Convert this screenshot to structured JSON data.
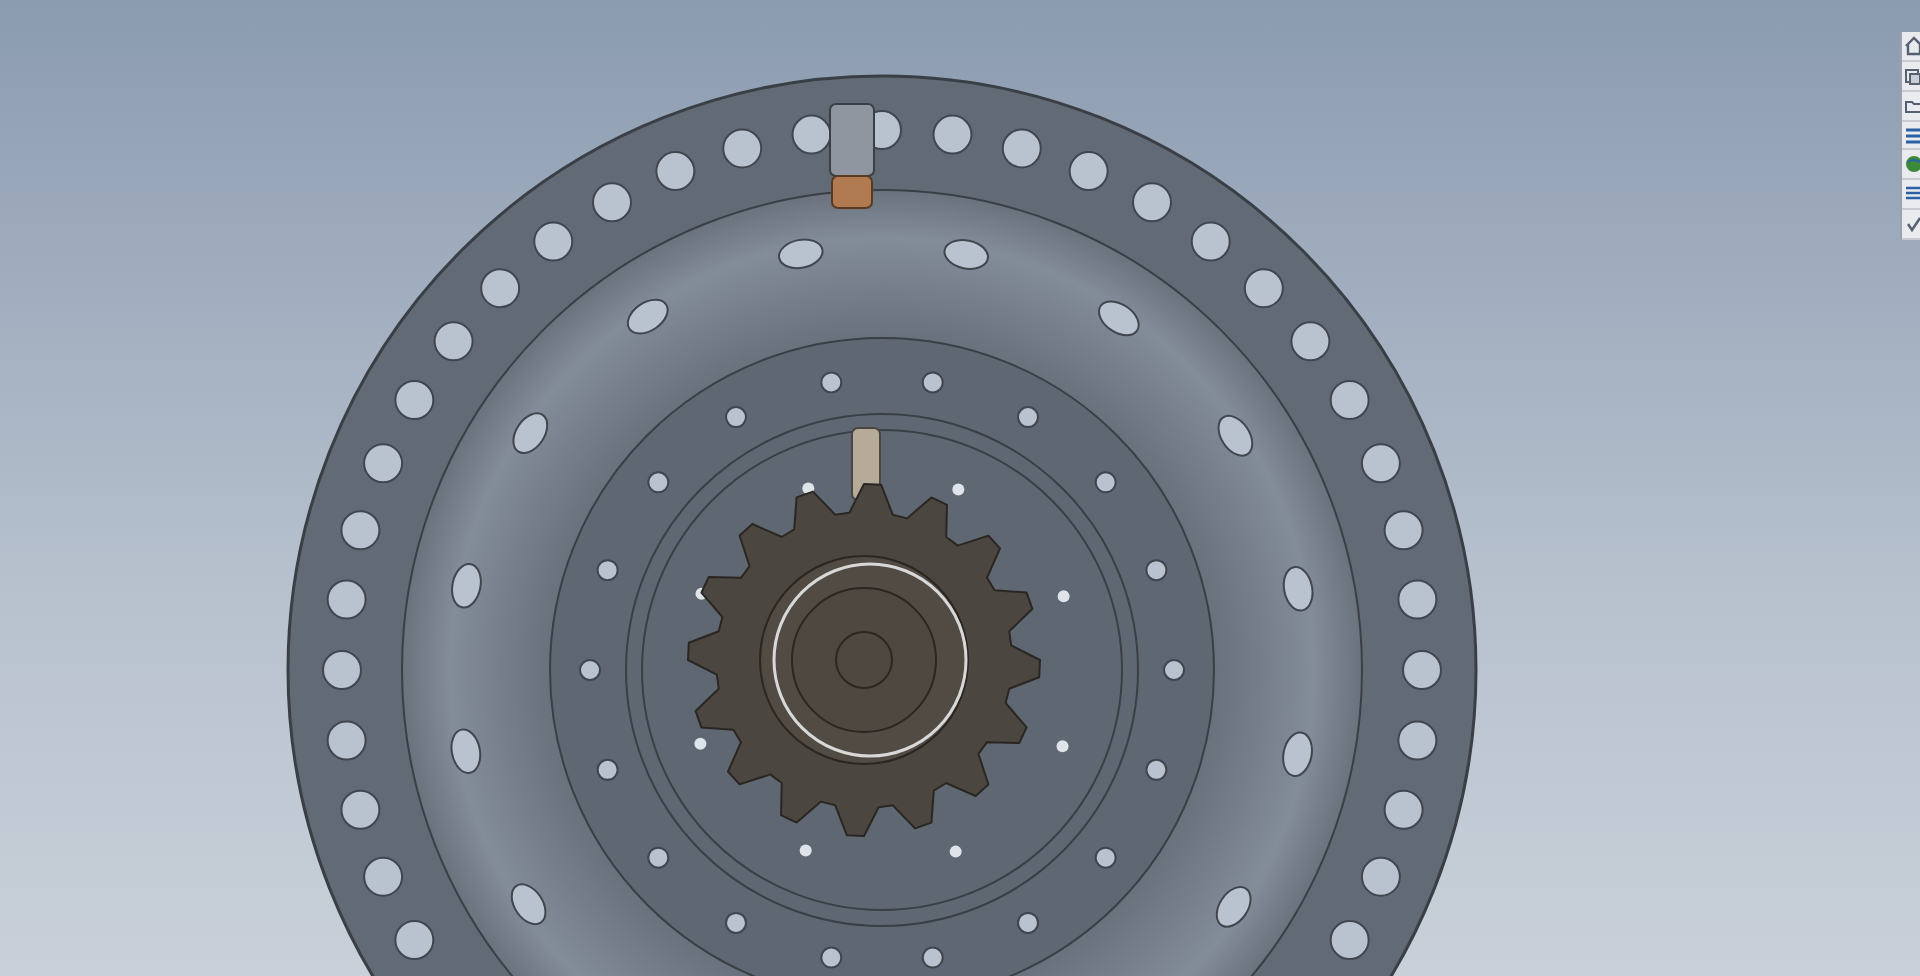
{
  "task_pane": {
    "tabs": [
      {
        "kind": "home"
      },
      {
        "kind": "parts"
      },
      {
        "kind": "folder"
      },
      {
        "kind": "library"
      },
      {
        "kind": "globe"
      },
      {
        "kind": "list"
      },
      {
        "kind": "check"
      }
    ]
  }
}
